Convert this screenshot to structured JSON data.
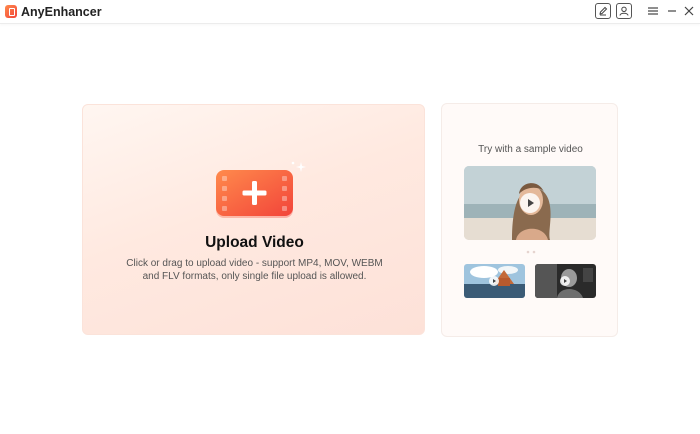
{
  "app": {
    "title": "AnyEnhancer"
  },
  "titlebar": {
    "buttons": [
      "edit-icon",
      "account-icon"
    ],
    "window_controls": [
      "menu-icon",
      "minimize-icon",
      "close-icon"
    ]
  },
  "upload": {
    "title": "Upload Video",
    "description_line1": "Click or drag to upload video - support MP4, MOV, WEBM",
    "description_line2": "and FLV formats, only single file upload is allowed.",
    "icon": "add-video-icon"
  },
  "samples": {
    "title": "Try with a sample video",
    "items": [
      {
        "name": "sample-video-woman",
        "icon": "play-icon"
      },
      {
        "name": "sample-video-landscape",
        "icon": "play-icon"
      },
      {
        "name": "sample-video-bw",
        "icon": "play-icon"
      }
    ]
  },
  "colors": {
    "accent": "#f2443a",
    "accent_light": "#ff8a4c",
    "card_bg": "#ffe9e0"
  }
}
